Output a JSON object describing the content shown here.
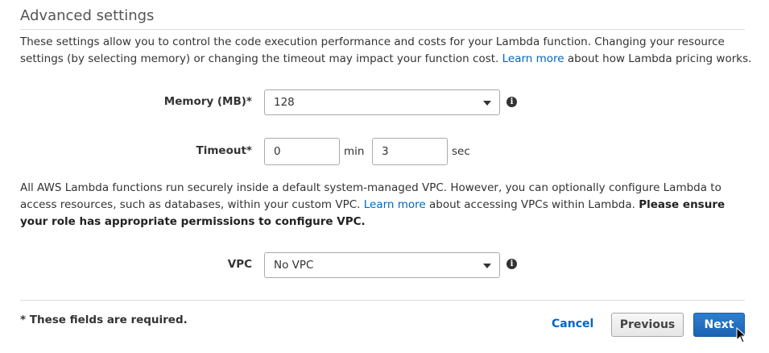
{
  "section": {
    "title": "Advanced settings"
  },
  "intro": {
    "text_before": "These settings allow you to control the code execution performance and costs for your Lambda function. Changing your resource settings (by selecting memory) or changing the timeout may impact your function cost. ",
    "link": "Learn more",
    "text_after": " about how Lambda pricing works."
  },
  "memory": {
    "label": "Memory (MB)*",
    "value": "128",
    "info_icon": "info-icon"
  },
  "timeout": {
    "label": "Timeout*",
    "minutes": "0",
    "minutes_unit": "min",
    "seconds": "3",
    "seconds_unit": "sec"
  },
  "vpc_text": {
    "text_before": "All AWS Lambda functions run securely inside a default system-managed VPC. However, you can optionally configure Lambda to access resources, such as databases, within your custom VPC. ",
    "link": "Learn more",
    "text_middle": " about accessing VPCs within Lambda. ",
    "bold": "Please ensure your role has appropriate permissions to configure VPC."
  },
  "vpc": {
    "label": "VPC",
    "value": "No VPC",
    "info_icon": "info-icon"
  },
  "footer": {
    "required_note": "* These fields are required.",
    "cancel_label": "Cancel",
    "previous_label": "Previous",
    "next_label": "Next"
  },
  "colors": {
    "link": "#0066c0",
    "primary_button": "#1a63b0"
  }
}
